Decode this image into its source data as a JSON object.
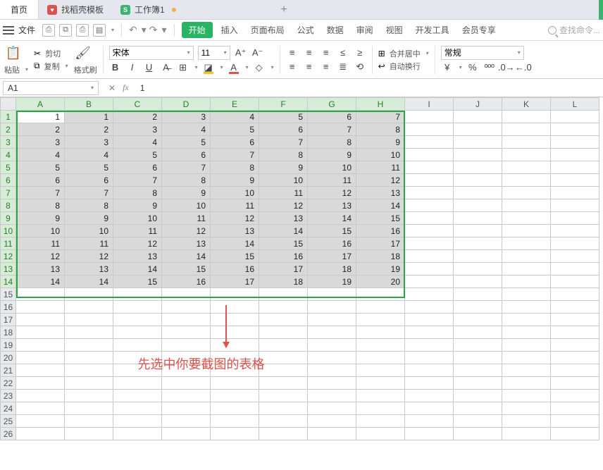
{
  "tabs": {
    "home": "首页",
    "templates": "找稻壳模板",
    "workbook": "工作簿1"
  },
  "menu": {
    "file": "文件",
    "start": "开始",
    "items": [
      "插入",
      "页面布局",
      "公式",
      "数据",
      "审阅",
      "视图",
      "开发工具",
      "会员专享"
    ],
    "search_placeholder": "查找命令..."
  },
  "ribbon": {
    "paste": "粘贴",
    "cut": "剪切",
    "copy": "复制",
    "format_painter": "格式刷",
    "font_name": "宋体",
    "font_size": "11",
    "merge_center": "合并居中",
    "wrap_text": "自动换行",
    "number_format": "常规"
  },
  "fbar": {
    "namebox": "A1",
    "formula": "1"
  },
  "grid": {
    "cols": [
      "A",
      "B",
      "C",
      "D",
      "E",
      "F",
      "G",
      "H",
      "I",
      "J",
      "K",
      "L"
    ],
    "selected_cols": 8,
    "rows": 26,
    "selected_rows": 14,
    "data": [
      [
        1,
        1,
        2,
        3,
        4,
        5,
        6,
        7
      ],
      [
        2,
        2,
        3,
        4,
        5,
        6,
        7,
        8
      ],
      [
        3,
        3,
        4,
        5,
        6,
        7,
        8,
        9
      ],
      [
        4,
        4,
        5,
        6,
        7,
        8,
        9,
        10
      ],
      [
        5,
        5,
        6,
        7,
        8,
        9,
        10,
        11
      ],
      [
        6,
        6,
        7,
        8,
        9,
        10,
        11,
        12
      ],
      [
        7,
        7,
        8,
        9,
        10,
        11,
        12,
        13
      ],
      [
        8,
        8,
        9,
        10,
        11,
        12,
        13,
        14
      ],
      [
        9,
        9,
        10,
        11,
        12,
        13,
        14,
        15
      ],
      [
        10,
        10,
        11,
        12,
        13,
        14,
        15,
        16
      ],
      [
        11,
        11,
        12,
        13,
        14,
        15,
        16,
        17
      ],
      [
        12,
        12,
        13,
        14,
        15,
        16,
        17,
        18
      ],
      [
        13,
        13,
        14,
        15,
        16,
        17,
        18,
        19
      ],
      [
        14,
        14,
        15,
        16,
        17,
        18,
        19,
        20
      ]
    ]
  },
  "annotation": "先选中你要截图的表格"
}
